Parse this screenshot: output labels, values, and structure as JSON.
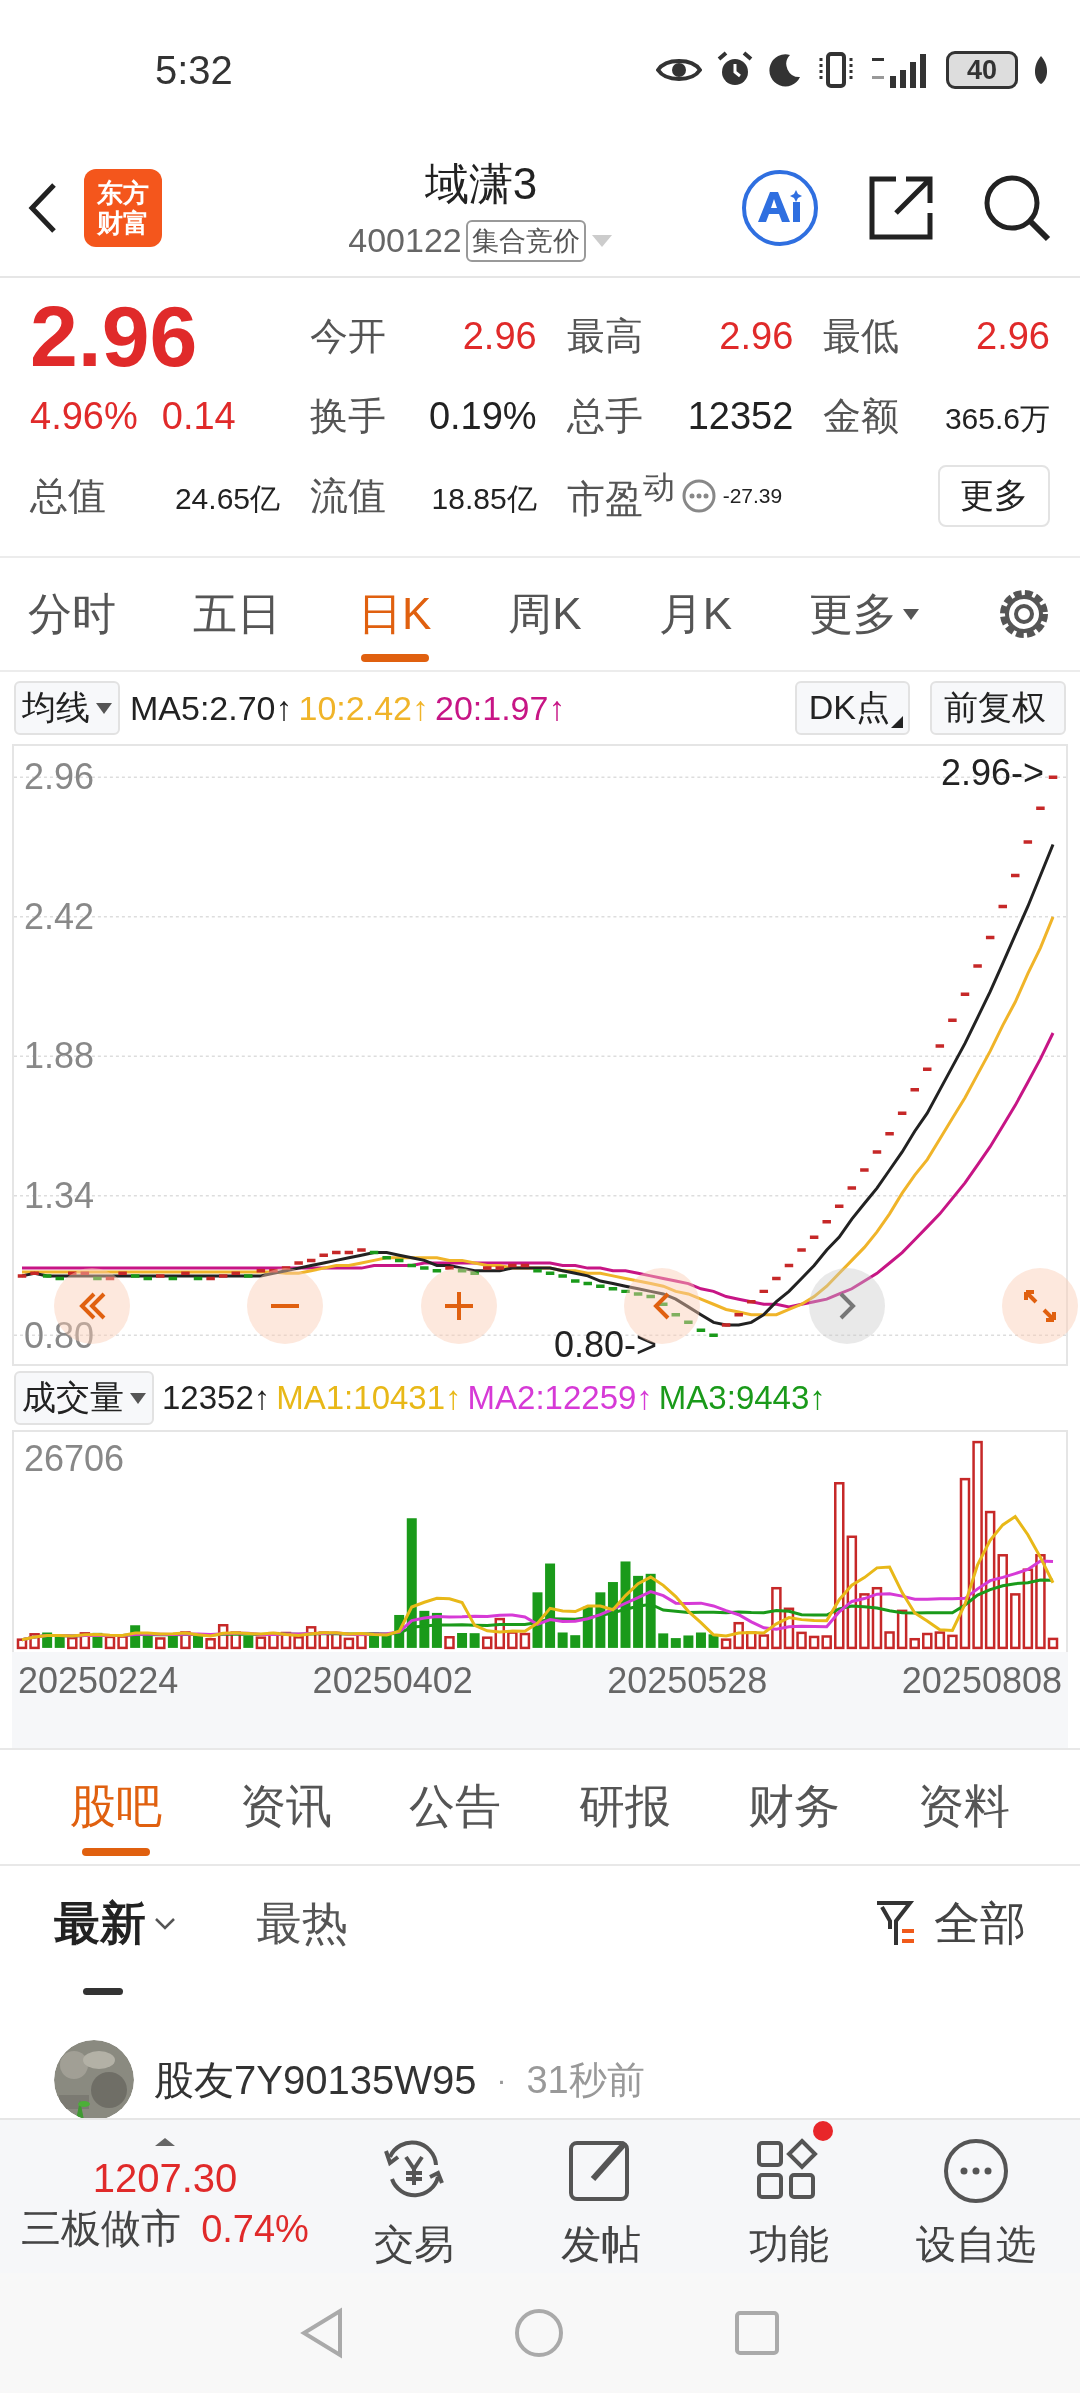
{
  "status_bar": {
    "time": "5:32",
    "battery": "40"
  },
  "header": {
    "logo": [
      "东方",
      "财富"
    ],
    "title": "域潇3",
    "code": "400122",
    "badge": "集合竞价"
  },
  "quote": {
    "price": "2.96",
    "change_pct": "4.96%",
    "change": "0.14",
    "stats": [
      {
        "kind": "stat",
        "label": "今开",
        "value": "2.96",
        "color": "#e02a2a"
      },
      {
        "kind": "stat",
        "label": "最高",
        "value": "2.96",
        "color": "#e02a2a"
      },
      {
        "kind": "stat",
        "label": "最低",
        "value": "2.96",
        "color": "#e02a2a"
      },
      {
        "kind": "stat",
        "label": "换手",
        "value": "0.19%",
        "color": "#222222"
      },
      {
        "kind": "stat",
        "label": "总手",
        "value": "12352",
        "color": "#222222"
      },
      {
        "kind": "small",
        "label": "金额",
        "value": "365.6万",
        "color": "#222222"
      },
      {
        "kind": "small",
        "label": "总值",
        "value": "24.65亿",
        "color": "#222222"
      },
      {
        "kind": "small",
        "label": "流值",
        "value": "18.85亿",
        "color": "#222222"
      },
      {
        "kind": "pe",
        "label": "市盈$^{动}$",
        "value": "-27.39",
        "color": "#222222"
      }
    ],
    "more_button": "更多"
  },
  "chart_tabs": [
    {
      "label": "分时",
      "selected": false,
      "kind": "tab"
    },
    {
      "label": "五日",
      "selected": false,
      "kind": "tab"
    },
    {
      "label": "日K",
      "selected": true,
      "kind": "tab"
    },
    {
      "label": "周K",
      "selected": false,
      "kind": "tab"
    },
    {
      "label": "月K",
      "selected": false,
      "kind": "tab"
    },
    {
      "label": "更多",
      "selected": false,
      "kind": "dropdown"
    }
  ],
  "ma_legend": {
    "selector": "均线",
    "items": [
      {
        "text": "MA5:2.70↑",
        "color": "#222222"
      },
      {
        "text": "10:2.42↑",
        "color": "#f0b429"
      },
      {
        "text": "20:1.97↑",
        "color": "#c71585"
      }
    ],
    "buttons": [
      {
        "label": "DK点",
        "kind": "corner"
      },
      {
        "label": "前复权",
        "kind": "plain"
      }
    ]
  },
  "price_chart": {
    "high_mark": "2.96->",
    "low_mark": "0.80->",
    "chart_data": {
      "type": "line",
      "ylim": [
        0.69,
        3.08
      ],
      "grid": true,
      "yticks": [
        {
          "value": 2.96,
          "label": "2.96"
        },
        {
          "value": 2.42,
          "label": "2.42"
        },
        {
          "value": 1.88,
          "label": "1.88"
        },
        {
          "value": 1.34,
          "label": "1.34"
        },
        {
          "value": 0.8,
          "label": "0.80"
        }
      ],
      "series": [
        {
          "color": "#c62828",
          "values": [
            1.03,
            1.04,
            null,
            null,
            1.04,
            1.04,
            null,
            1.02,
            1.04,
            null,
            null,
            1.03,
            null,
            1.04,
            null,
            1.02,
            1.03,
            1.04,
            null,
            1.05,
            1.05,
            1.06,
            1.08,
            1.09,
            1.11,
            1.12,
            1.12,
            1.13,
            null,
            null,
            null,
            null,
            null,
            null,
            1.06,
            null,
            null,
            1.06,
            1.06,
            1.07,
            1.07,
            null,
            null,
            null,
            null,
            null,
            null,
            null,
            null,
            null,
            null,
            null,
            null,
            null,
            null,
            null,
            0.84,
            0.88,
            0.93,
            0.97,
            1.02,
            1.07,
            1.13,
            1.18,
            1.24,
            1.3,
            1.37,
            1.44,
            1.51,
            1.58,
            1.66,
            1.75,
            1.83,
            1.92,
            2.02,
            2.12,
            2.23,
            2.34,
            2.46,
            2.58,
            2.71,
            2.84,
            2.96
          ]
        },
        {
          "color": "#1a9a1a",
          "values": [
            null,
            null,
            1.03,
            1.02,
            null,
            null,
            1.02,
            null,
            null,
            1.03,
            1.02,
            null,
            1.02,
            null,
            1.02,
            null,
            null,
            null,
            1.03,
            null,
            null,
            null,
            null,
            null,
            null,
            null,
            null,
            null,
            1.12,
            1.1,
            1.09,
            1.07,
            1.06,
            1.05,
            null,
            1.05,
            1.04,
            null,
            null,
            null,
            null,
            1.05,
            1.04,
            1.03,
            1.01,
            1.0,
            0.99,
            0.98,
            0.97,
            0.96,
            0.95,
            0.92,
            0.88,
            0.85,
            0.82,
            0.8,
            null,
            null,
            null,
            null,
            null,
            null,
            null,
            null,
            null,
            null,
            null,
            null,
            null,
            null,
            null,
            null,
            null,
            null,
            null,
            null,
            null,
            null,
            null,
            null,
            null,
            null,
            null
          ]
        },
        {
          "color": "#c71585",
          "values": [
            1.06,
            1.06,
            1.06,
            1.06,
            1.06,
            1.06,
            1.06,
            1.06,
            1.06,
            1.06,
            1.06,
            1.06,
            1.06,
            1.06,
            1.06,
            1.06,
            1.06,
            1.06,
            1.06,
            1.06,
            1.06,
            1.06,
            1.06,
            1.06,
            1.06,
            1.06,
            1.06,
            1.06,
            1.07,
            1.07,
            1.07,
            1.07,
            1.08,
            1.08,
            1.08,
            1.08,
            1.08,
            1.08,
            1.08,
            1.08,
            1.08,
            1.08,
            1.08,
            1.07,
            1.07,
            1.06,
            1.06,
            1.05,
            1.05,
            1.04,
            1.03,
            1.02,
            1.01,
            1.0,
            0.98,
            0.97,
            0.95,
            0.94,
            0.93,
            0.92,
            0.92,
            0.91,
            0.92,
            0.93,
            0.94,
            0.96,
            0.98,
            1.01,
            1.04,
            1.08,
            1.12,
            1.17,
            1.22,
            1.27,
            1.33,
            1.39,
            1.46,
            1.53,
            1.61,
            1.69,
            1.78,
            1.87,
            1.97
          ]
        },
        {
          "color": "#f0b429",
          "values": [
            1.045,
            1.045,
            1.045,
            1.045,
            1.045,
            1.045,
            1.045,
            1.045,
            1.045,
            1.045,
            1.045,
            1.045,
            1.045,
            1.045,
            1.045,
            1.045,
            1.045,
            1.045,
            1.045,
            1.045,
            1.045,
            1.04,
            1.04,
            1.05,
            1.06,
            1.07,
            1.07,
            1.08,
            1.09,
            1.1,
            1.1,
            1.1,
            1.1,
            1.1,
            1.09,
            1.09,
            1.08,
            1.07,
            1.07,
            1.06,
            1.06,
            1.06,
            1.06,
            1.05,
            1.05,
            1.04,
            1.04,
            1.03,
            1.02,
            1.01,
            1.0,
            0.99,
            0.97,
            0.96,
            0.94,
            0.92,
            0.9,
            0.89,
            0.88,
            0.88,
            0.88,
            0.9,
            0.92,
            0.95,
            0.99,
            1.04,
            1.09,
            1.14,
            1.2,
            1.27,
            1.35,
            1.42,
            1.48,
            1.56,
            1.64,
            1.72,
            1.81,
            1.9,
            2.0,
            2.09,
            2.2,
            2.3,
            2.42
          ]
        },
        {
          "color": "#222222",
          "values": [
            1.03,
            1.04,
            1.03,
            1.03,
            1.03,
            1.03,
            1.03,
            1.03,
            1.03,
            1.03,
            1.03,
            1.03,
            1.03,
            1.03,
            1.03,
            1.03,
            1.03,
            1.03,
            1.03,
            1.03,
            1.04,
            1.05,
            1.06,
            1.07,
            1.08,
            1.09,
            1.1,
            1.11,
            1.12,
            1.12,
            1.11,
            1.1,
            1.09,
            1.07,
            1.07,
            1.06,
            1.05,
            1.05,
            1.05,
            1.06,
            1.06,
            1.06,
            1.06,
            1.05,
            1.04,
            1.03,
            1.01,
            1.0,
            0.99,
            0.98,
            0.97,
            0.96,
            0.94,
            0.91,
            0.88,
            0.85,
            0.84,
            0.84,
            0.85,
            0.88,
            0.93,
            0.97,
            1.02,
            1.07,
            1.13,
            1.18,
            1.25,
            1.31,
            1.37,
            1.44,
            1.51,
            1.59,
            1.66,
            1.75,
            1.84,
            1.93,
            2.03,
            2.13,
            2.24,
            2.35,
            2.46,
            2.58,
            2.7
          ]
        }
      ]
    }
  },
  "volume_legend": {
    "selector": "成交量",
    "items": [
      {
        "text": "12352↑",
        "color": "#222222"
      },
      {
        "text": "MA1:10431↑",
        "color": "#e8b818"
      },
      {
        "text": "MA2:12259↑",
        "color": "#d63ad6"
      },
      {
        "text": "MA3:9443↑",
        "color": "#1a9a1a"
      }
    ]
  },
  "volume_chart": {
    "y_label": "26706",
    "dates": [
      "20250224",
      "20250402",
      "20250528",
      "20250808"
    ]
  },
  "content_tabs": [
    {
      "label": "股吧",
      "selected": true
    },
    {
      "label": "资讯",
      "selected": false
    },
    {
      "label": "公告",
      "selected": false
    },
    {
      "label": "研报",
      "selected": false
    },
    {
      "label": "财务",
      "selected": false
    },
    {
      "label": "资料",
      "selected": false
    }
  ],
  "feed_filters": {
    "sorts": [
      {
        "label": "最新",
        "selected": true
      },
      {
        "label": "最热",
        "selected": false
      }
    ],
    "filter": "全部"
  },
  "posts": [
    {
      "author": "股友7Y90135W95",
      "separator": "·",
      "time": "31秒前"
    }
  ],
  "bottom_bar": {
    "index_value": "1207.30",
    "index_name": "三板做市",
    "index_change": "0.74%",
    "actions": [
      {
        "label": "交易",
        "kind": "trade",
        "badge": false
      },
      {
        "label": "发帖",
        "kind": "post",
        "badge": false
      },
      {
        "label": "功能",
        "kind": "apps",
        "badge": true
      },
      {
        "label": "设自选",
        "kind": "more",
        "badge": false
      }
    ]
  }
}
